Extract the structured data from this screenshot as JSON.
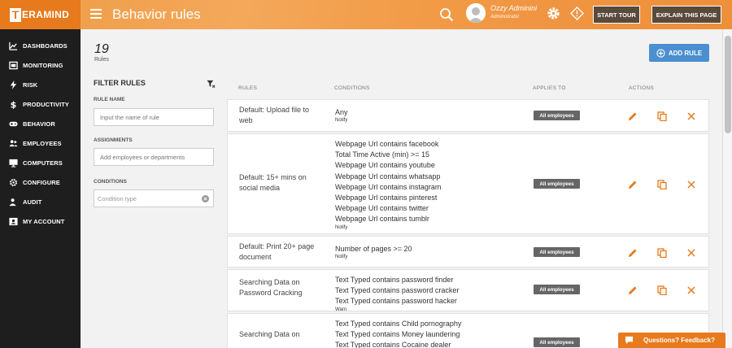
{
  "app": {
    "logo_letter": "T",
    "logo_rest": "ERAMIND",
    "brand_color": "#e77a1c",
    "accent_color": "#4a8fcf"
  },
  "sidebar": {
    "items": [
      {
        "label": "DASHBOARDS",
        "icon": "chart-icon"
      },
      {
        "label": "MONITORING",
        "icon": "monitor-icon"
      },
      {
        "label": "RISK",
        "icon": "bolt-icon"
      },
      {
        "label": "PRODUCTIVITY",
        "icon": "dollar-icon"
      },
      {
        "label": "BEHAVIOR",
        "icon": "gamepad-icon"
      },
      {
        "label": "EMPLOYEES",
        "icon": "users-icon"
      },
      {
        "label": "COMPUTERS",
        "icon": "desktop-icon"
      },
      {
        "label": "CONFIGURE",
        "icon": "gear-icon"
      },
      {
        "label": "AUDIT",
        "icon": "user-shield-icon"
      },
      {
        "label": "MY ACCOUNT",
        "icon": "id-card-icon"
      }
    ]
  },
  "header": {
    "title": "Behavior rules",
    "user_name": "Ozzy Adminini",
    "user_role": "Administrator",
    "start_tour_label": "START TOUR",
    "explain_label": "EXPLAIN THIS PAGE"
  },
  "main": {
    "count": "19",
    "count_label": "Rules",
    "add_rule_label": "ADD RULE"
  },
  "filter": {
    "title": "FILTER RULES",
    "rule_name_label": "RULE NAME",
    "rule_name_placeholder": "Input the name of rule",
    "assignments_label": "ASSIGNMENTS",
    "assignments_placeholder": "Add employees or departments",
    "conditions_label": "CONDITIONS",
    "conditions_placeholder": "Condition type"
  },
  "table": {
    "columns": [
      "RULES",
      "CONDITIONS",
      "APPLIES TO",
      "ACTIONS"
    ],
    "rows": [
      {
        "name": "Default: Upload file to web",
        "conditions": [
          "Any"
        ],
        "action": "Notify",
        "applies_to": "All employees"
      },
      {
        "name": "Default: 15+ mins on social media",
        "conditions": [
          "Webpage Url contains facebook",
          "Total Time Active (min) >= 15",
          "Webpage Url contains youtube",
          "Webpage Url contains whatsapp",
          "Webpage Url contains instagram",
          "Webpage Url contains pinterest",
          "Webpage Url contains twitter",
          "Webpage Url contains tumblr"
        ],
        "action": "Notify",
        "applies_to": "All employees"
      },
      {
        "name": "Default: Print 20+ page document",
        "conditions": [
          "Number of pages >= 20"
        ],
        "action": "Notify",
        "applies_to": "All employees"
      },
      {
        "name": "Searching Data on Password Cracking",
        "conditions": [
          "Text Typed contains password finder",
          "Text Typed contains password cracker",
          "Text Typed contains password hacker"
        ],
        "action": "Warn",
        "applies_to": "All employees"
      },
      {
        "name": "Searching Data on",
        "conditions": [
          "Text Typed contains Child pornography",
          "Text Typed contains Money laundering",
          "Text Typed contains Cocaine dealer"
        ],
        "action": "",
        "applies_to": "All employees"
      }
    ]
  },
  "feedback": {
    "label": "Questions? Feedback?"
  }
}
